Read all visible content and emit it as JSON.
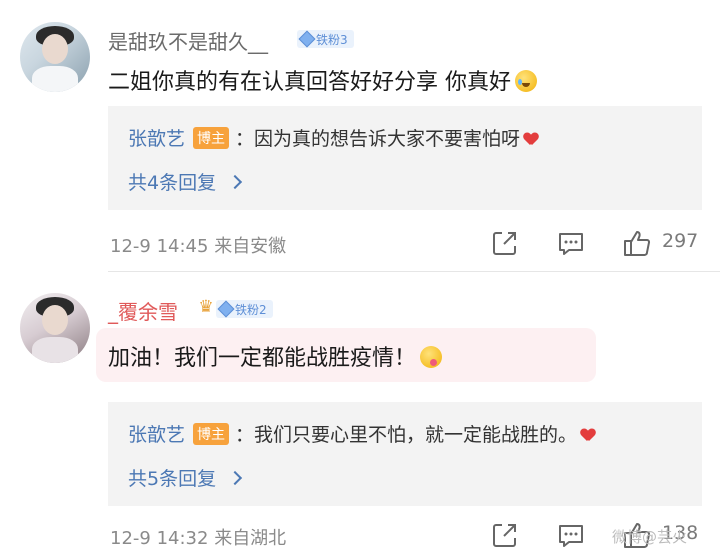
{
  "comments": [
    {
      "username": "是甜玖不是甜久__",
      "fan_badge": "铁粉3",
      "content": "二姐你真的有在认真回答好好分享 你真好",
      "reply": {
        "author": "张歆艺",
        "role_badge": "博主",
        "text": "：因为真的想告诉大家不要害怕呀"
      },
      "more_replies": "共4条回复",
      "time": "12-9 14:45",
      "location": "来自安徽",
      "likes": "297"
    },
    {
      "username": "_覆余雪",
      "fan_badge": "铁粉2",
      "content": "加油！我们一定都能战胜疫情！",
      "reply": {
        "author": "张歆艺",
        "role_badge": "博主",
        "text": "：我们只要心里不怕，就一定能战胜的。"
      },
      "more_replies": "共5条回复",
      "time": "12-9 14:32",
      "location": "来自湖北",
      "likes": "138"
    }
  ],
  "watermark": "微博@芸火",
  "colors": {
    "link_blue": "#4c78b4",
    "blogger_badge": "#f7a23c",
    "fan_badge_bg": "#eaf2fc",
    "reply_bg": "#f3f3f3",
    "heart": "#e33d3d"
  },
  "icons": [
    "share-icon",
    "comment-icon",
    "thumbs-up-icon",
    "diamond-icon",
    "crown-icon",
    "heart-emoji-icon"
  ]
}
